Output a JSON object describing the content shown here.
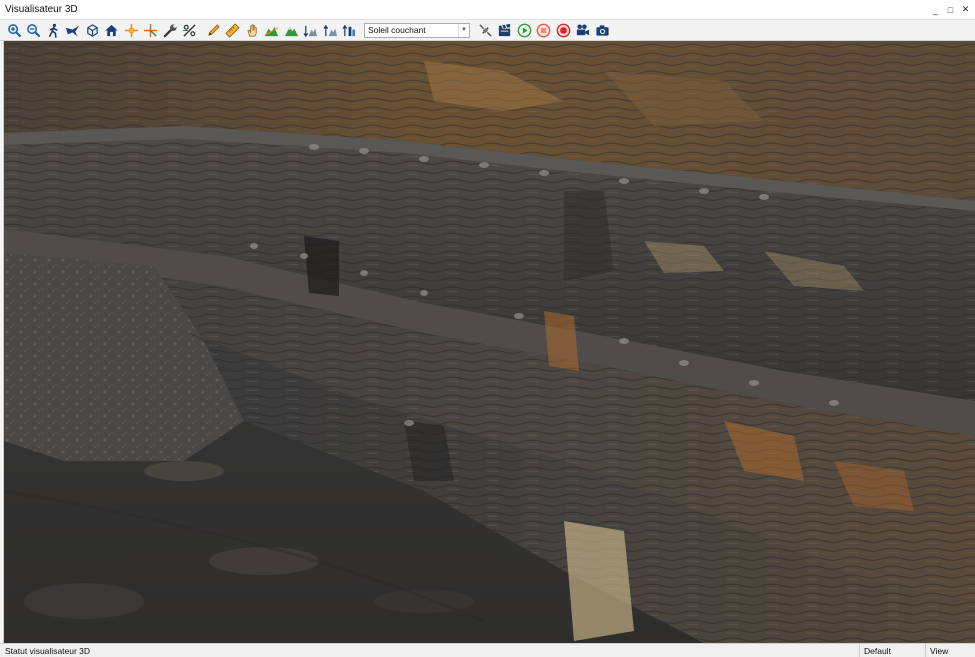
{
  "window": {
    "title": "Visualisateur 3D",
    "controls": [
      {
        "name": "minimize-button",
        "glyph": "_"
      },
      {
        "name": "maximize-button",
        "glyph": "□"
      },
      {
        "name": "close-button",
        "glyph": "✕"
      }
    ]
  },
  "toolbar": {
    "tools": [
      {
        "icon": "zoom-in-icon"
      },
      {
        "icon": "zoom-out-icon"
      },
      {
        "icon": "walk-icon"
      },
      {
        "icon": "fly-icon"
      },
      {
        "icon": "cube-view-icon"
      },
      {
        "icon": "home-icon"
      },
      {
        "icon": "pick-point-icon"
      },
      {
        "icon": "crosshair-icon"
      },
      {
        "icon": "wrench-icon"
      },
      {
        "icon": "slope-percent-icon"
      },
      {
        "icon": "pencil-icon"
      },
      {
        "icon": "ruler-icon"
      },
      {
        "icon": "pan-hand-icon"
      },
      {
        "icon": "terrain-profile-icon"
      },
      {
        "icon": "terrain-fill-icon"
      },
      {
        "icon": "elevation-down-icon"
      },
      {
        "icon": "elevation-up-icon"
      },
      {
        "icon": "sun-elevation-icon"
      }
    ],
    "lighting_select": {
      "value": "Soleil couchant"
    },
    "tools_after": [
      {
        "icon": "satellite-icon"
      },
      {
        "icon": "clapperboard-icon"
      },
      {
        "icon": "play-icon"
      },
      {
        "icon": "stop-icon"
      },
      {
        "icon": "record-icon"
      },
      {
        "icon": "video-camera-icon"
      },
      {
        "icon": "photo-camera-icon"
      }
    ],
    "colors": {
      "accent_green": "#2e9a3a",
      "stop_red": "#e05a4a",
      "record_red": "#d8262b",
      "blue": "#1f5fa8"
    }
  },
  "viewport": {
    "content": "quarry-3d-model"
  },
  "statusbar": {
    "message": "Statut visualisateur 3D",
    "profile": "Default",
    "mode": "View"
  }
}
